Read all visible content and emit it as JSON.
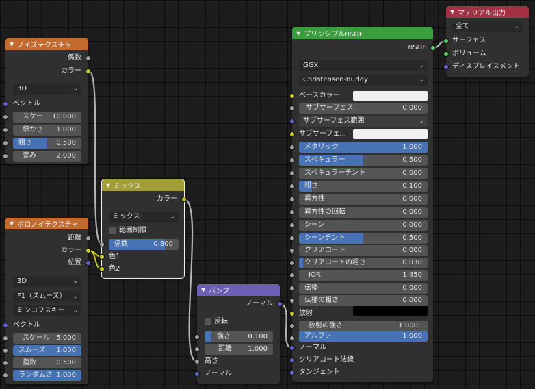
{
  "noise": {
    "title": "ノイズテクスチャ",
    "out_fac": "係数",
    "out_color": "カラー",
    "dimension": "3D",
    "vector": "ベクトル",
    "scale_label": "スケー",
    "scale_value": "10.000",
    "detail_label": "細かさ",
    "detail_value": "1.000",
    "roughness_label": "粗さ",
    "roughness_value": "0.500",
    "roughness_level": 0.5,
    "distortion_label": "歪み",
    "distortion_value": "2.000"
  },
  "voronoi": {
    "title": "ボロノイテクスチャ",
    "out_distance": "距離",
    "out_color": "カラー",
    "out_position": "位置",
    "dimension": "3D",
    "feature": "F1（スムーズ）",
    "metric": "ミンコフスキー",
    "vector": "ベクトル",
    "scale_label": "スケール",
    "scale_value": "5.000",
    "smooth_label": "スムーズ",
    "smooth_value": "1.000",
    "smooth_level": 1.0,
    "exponent_label": "指数",
    "exponent_value": "0.500",
    "randomness_label": "ランダムさ",
    "randomness_value": "1.000",
    "randomness_level": 1.0
  },
  "mix": {
    "title": "ミックス",
    "out_color": "カラー",
    "blend": "ミックス",
    "clamp": "範囲制限",
    "fac_label": "係数",
    "fac_value": "0.800",
    "fac_level": 0.8,
    "color1": "色1",
    "color2": "色2"
  },
  "bump": {
    "title": "バンプ",
    "out_normal": "ノーマル",
    "invert": "反転",
    "strength_label": "強さ",
    "strength_value": "0.100",
    "strength_level": 0.1,
    "distance_label": "距離",
    "distance_value": "1.000",
    "height": "高さ",
    "normal": "ノーマル"
  },
  "bsdf": {
    "title": "プリンシプルBSDF",
    "out_bsdf": "BSDF",
    "distribution": "GGX",
    "subsurface_method": "Christensen-Burley",
    "base_color": "ベースカラー",
    "subsurface_label": "サブサーフェス",
    "subsurface_value": "0.000",
    "subsurface_radius": "サブサーフェス範囲",
    "subsurface_color": "サブサーフェ...",
    "metallic_label": "メタリック",
    "metallic_value": "1.000",
    "metallic_level": 1.0,
    "specular_label": "スペキュラー",
    "specular_value": "0.500",
    "specular_level": 0.5,
    "specular_tint_label": "スペキュラーチント",
    "specular_tint_value": "0.000",
    "roughness_label": "粗さ",
    "roughness_value": "0.100",
    "roughness_level": 0.1,
    "anisotropic_label": "異方性",
    "anisotropic_value": "0.000",
    "aniso_rotation_label": "異方性の回転",
    "aniso_rotation_value": "0.000",
    "sheen_label": "シーン",
    "sheen_value": "0.000",
    "sheen_tint_label": "シーンチント",
    "sheen_tint_value": "0.500",
    "sheen_tint_level": 0.5,
    "clearcoat_label": "クリアコート",
    "clearcoat_value": "0.000",
    "clearcoat_rough_label": "クリアコートの粗さ",
    "clearcoat_rough_value": "0.030",
    "clearcoat_rough_level": 0.03,
    "ior_label": "IOR",
    "ior_value": "1.450",
    "transmission_label": "伝播",
    "transmission_value": "0.000",
    "transmission_rough_label": "伝播の粗さ",
    "transmission_rough_value": "0.000",
    "emission": "放射",
    "emission_strength_label": "放射の強さ",
    "emission_strength_value": "1.000",
    "alpha_label": "アルファ",
    "alpha_value": "1.000",
    "alpha_level": 1.0,
    "normal": "ノーマル",
    "clearcoat_normal": "クリアコート法線",
    "tangent": "タンジェント"
  },
  "output": {
    "title": "マテリアル出力",
    "target": "全て",
    "surface": "サーフェス",
    "volume": "ボリューム",
    "displacement": "ディスプレイスメント"
  },
  "colors": {
    "texture_header": "#c26a2f",
    "mix_header": "#a39d36",
    "vector_header": "#6b5fb5",
    "shader_header": "#3a9e3e",
    "output_header": "#a03244",
    "accent_fill": "#4772b3",
    "base_color_swatch": "#f0f0f0",
    "emission_swatch": "#000000"
  }
}
